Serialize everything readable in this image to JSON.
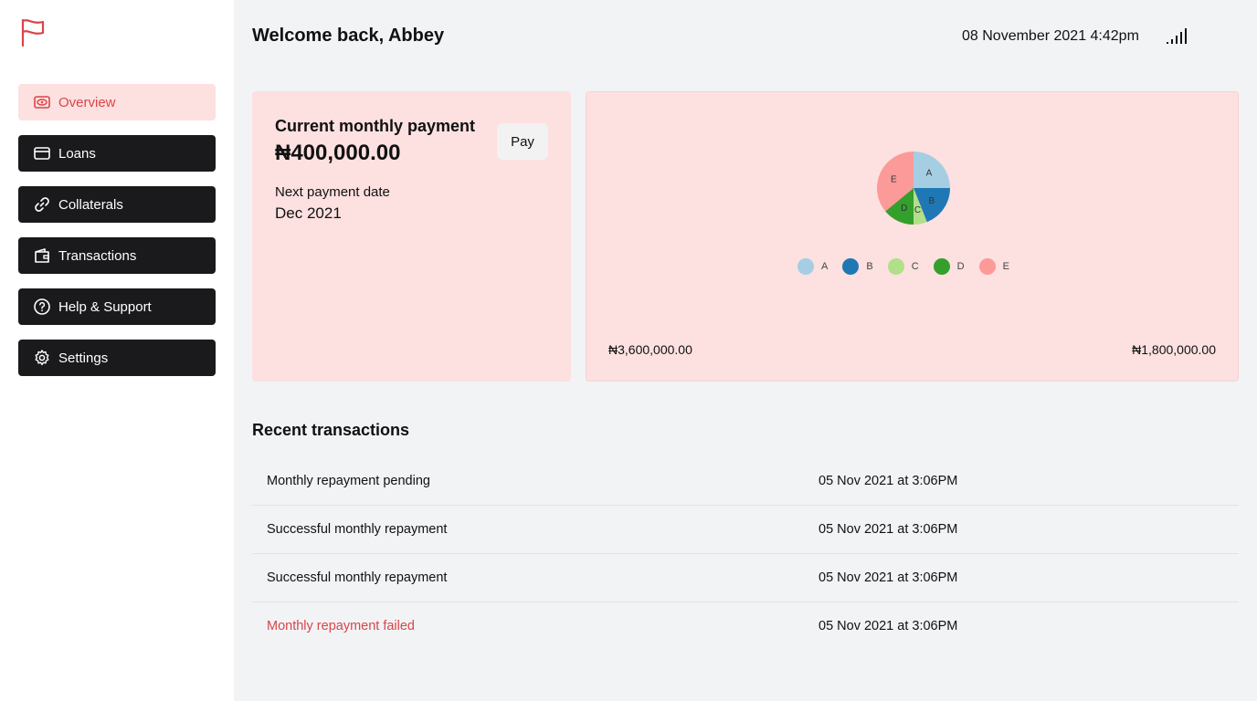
{
  "sidebar": {
    "items": [
      {
        "label": "Overview",
        "icon": "eye-icon",
        "active": true
      },
      {
        "label": "Loans",
        "icon": "credit-card-icon"
      },
      {
        "label": "Collaterals",
        "icon": "link-icon"
      },
      {
        "label": "Transactions",
        "icon": "wallet-icon"
      },
      {
        "label": "Help & Support",
        "icon": "help-circle-icon"
      },
      {
        "label": "Settings",
        "icon": "gear-icon"
      }
    ]
  },
  "header": {
    "title": "Welcome back, Abbey",
    "datetime": "08 November 2021 4:42pm"
  },
  "payment_card": {
    "title": "Current monthly payment",
    "amount": "₦400,000.00",
    "pay_label": "Pay",
    "next_label": "Next payment date",
    "next_value": "Dec 2021"
  },
  "chart_card": {
    "amount_left": "₦3,600,000.00",
    "amount_right": "₦1,800,000.00"
  },
  "chart_data": {
    "type": "pie",
    "categories": [
      "A",
      "B",
      "C",
      "D",
      "E"
    ],
    "values": [
      25,
      19,
      6,
      14,
      36
    ],
    "colors": [
      "#a6cee3",
      "#1f78b4",
      "#b2df8a",
      "#33a02c",
      "#fb9a99"
    ],
    "legend": "bottom"
  },
  "transactions": {
    "title": "Recent transactions",
    "rows": [
      {
        "description": "Monthly repayment pending",
        "date": "05 Nov 2021 at 3:06PM",
        "status": "pending"
      },
      {
        "description": "Successful monthly repayment",
        "date": "05 Nov 2021 at 3:06PM",
        "status": "success"
      },
      {
        "description": "Successful monthly repayment",
        "date": "05 Nov 2021 at 3:06PM",
        "status": "success"
      },
      {
        "description": "Monthly repayment failed",
        "date": "05 Nov 2021 at 3:06PM",
        "status": "failed"
      }
    ]
  },
  "colors": {
    "accent": "#d9454a",
    "active_bg": "#fde0e0",
    "nav_bg": "#1a1a1c"
  }
}
